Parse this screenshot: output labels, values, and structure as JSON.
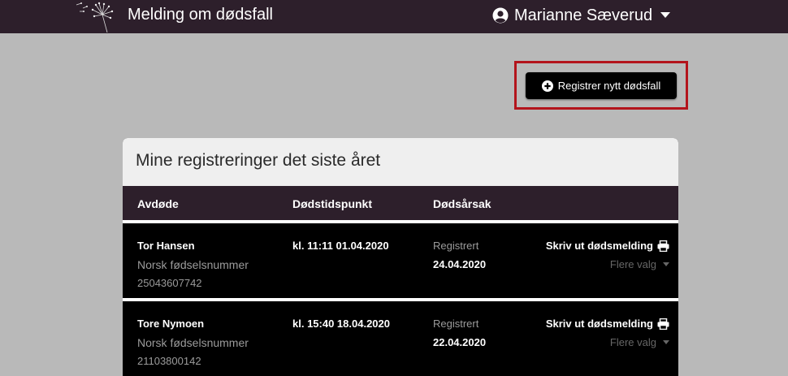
{
  "header": {
    "app_title": "Melding om dødsfall",
    "user_name": "Marianne Sæverud"
  },
  "actions": {
    "register_button": "Registrer nytt dødsfall"
  },
  "card": {
    "title": "Mine registreringer det siste året",
    "columns": [
      "Avdøde",
      "Dødstidspunkt",
      "Dødsårsak"
    ],
    "rows": [
      {
        "name": "Tor Hansen",
        "id_type": "Norsk fødselsnummer",
        "id_number": "25043607742",
        "time": "kl. 11:11 01.04.2020",
        "status_label": "Registrert",
        "status_date": "24.04.2020",
        "print_label": "Skriv ut dødsmelding",
        "more_label": "Flere valg"
      },
      {
        "name": "Tore Nymoen",
        "id_type": "Norsk fødselsnummer",
        "id_number": "21103800142",
        "time": "kl. 15:40 18.04.2020",
        "status_label": "Registrert",
        "status_date": "22.04.2020",
        "print_label": "Skriv ut dødsmelding",
        "more_label": "Flere valg"
      }
    ]
  },
  "colors": {
    "topbar": "#2d1f2b",
    "background": "#b9b9b9",
    "highlight": "#b3141c"
  },
  "icons": [
    "dandelion-logo-icon",
    "user-circle-icon",
    "caret-down-icon",
    "plus-circle-icon",
    "printer-icon"
  ]
}
